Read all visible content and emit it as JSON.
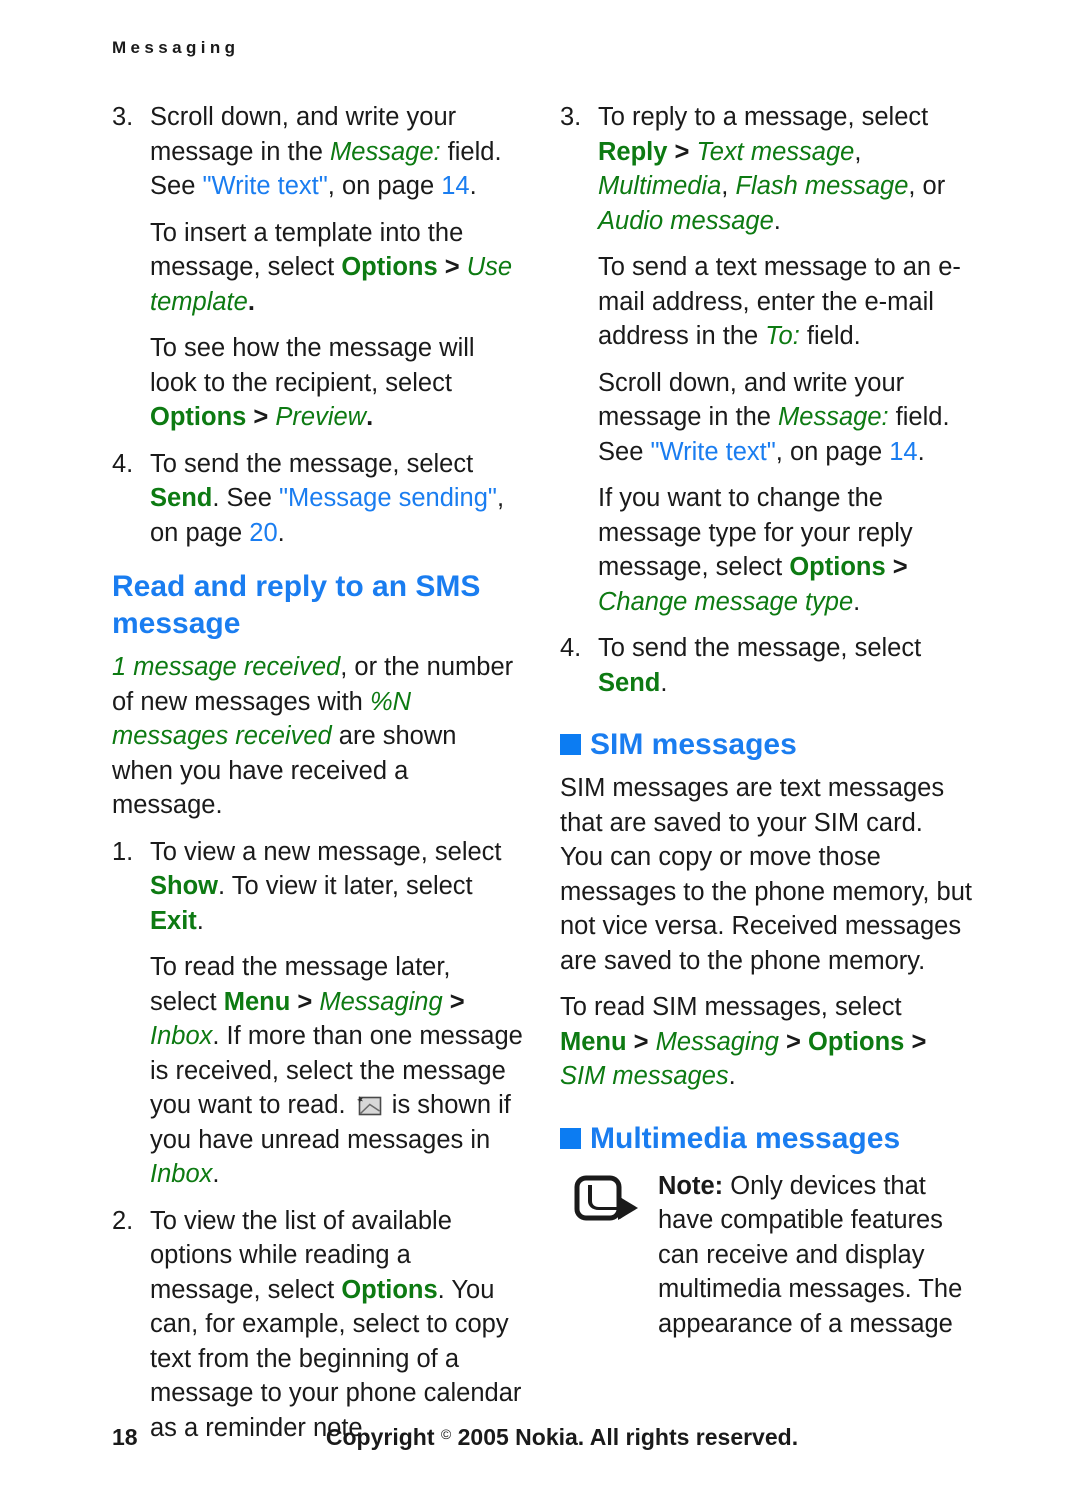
{
  "running_head": "Messaging",
  "colors": {
    "heading_blue": "#1a7df0",
    "ui_green": "#0d7a12",
    "link_blue": "#1a7df0",
    "body_black": "#1a1a1a"
  },
  "left_column": {
    "step3": {
      "number": "3.",
      "line1": "Scroll down, and write your message in the ",
      "field_message": "Message:",
      "line2": " field. See ",
      "link_write_text": "\"Write text\"",
      "line3": ", on page ",
      "page_ref": "14",
      "line4": "."
    },
    "para_template": {
      "t1": "To insert a template into the message, select ",
      "ui_options": "Options",
      "t2": " > ",
      "ui_use_template": "Use template",
      "t3": "."
    },
    "para_preview": {
      "t1": "To see how the message will look to the recipient, select ",
      "ui_options": "Options",
      "t2": " > ",
      "ui_preview": "Preview",
      "t3": "."
    },
    "step4": {
      "number": "4.",
      "t1": "To send the message, select ",
      "ui_send": "Send",
      "t2": ". See ",
      "link_message_sending": "\"Message sending\"",
      "t3": ", on page ",
      "page_ref": "20",
      "t4": "."
    },
    "heading_read_reply": "Read and reply to an SMS message",
    "para_received": {
      "ui_1_message_received": "1 message received",
      "t1": ", or the number of new messages with ",
      "ui_pct_n_messages_received": "%N messages received",
      "t2": " are shown when you have received a message."
    },
    "step1": {
      "number": "1.",
      "t1": "To view a new message, select ",
      "ui_show": "Show",
      "t2": ". To view it later, select ",
      "ui_exit": "Exit",
      "t3": "."
    },
    "para_read_later": {
      "t1": "To read the message later, select ",
      "ui_menu": "Menu",
      "sep1": " > ",
      "ui_messaging": "Messaging",
      "sep2": " > ",
      "ui_inbox": "Inbox",
      "t2": ". If more than one message is received, select the message you want to read. ",
      "icon": "unread-message-envelope-icon",
      "t3": " is shown if you have unread messages in ",
      "ui_inbox2": "Inbox",
      "t4": "."
    },
    "step2": {
      "number": "2.",
      "t1": "To view the list of available options while reading a message, select ",
      "ui_options": "Options",
      "t2": ". You can, for example, select to copy text from the beginning of a message to your phone calendar as a reminder note."
    }
  },
  "right_column": {
    "step3": {
      "number": "3.",
      "t1": "To reply to a message, select ",
      "ui_reply": "Reply",
      "sep": " > ",
      "ui_text_message": "Text message",
      "c1": ", ",
      "ui_multimedia": "Multimedia",
      "c2": ", ",
      "ui_flash_message": "Flash message",
      "c3": ", or ",
      "ui_audio_message": "Audio message",
      "c4": "."
    },
    "para_email": {
      "t1": "To send a text message to an e-mail address, enter the e-mail address in the ",
      "ui_to": "To:",
      "t2": " field."
    },
    "para_scroll": {
      "t1": "Scroll down, and write your message in the ",
      "ui_message": "Message:",
      "t2": " field. See ",
      "link_write_text": "\"Write text\"",
      "t3": ", on page ",
      "page_ref": "14",
      "t4": "."
    },
    "para_change_type": {
      "t1": "If you want to change the message type for your reply message, select ",
      "ui_options": "Options",
      "t2": " > ",
      "ui_change_message_type": "Change message type",
      "t3": "."
    },
    "step4": {
      "number": "4.",
      "t1": "To send the message, select ",
      "ui_send": "Send",
      "t2": "."
    },
    "heading_sim": "SIM messages",
    "para_sim_body": "SIM messages are text messages that are saved to your SIM card. You can copy or move those messages to the phone memory, but not vice versa. Received messages are saved to the phone memory.",
    "para_read_sim": {
      "t1": "To read SIM messages, select ",
      "ui_menu": "Menu",
      "sep1": " > ",
      "ui_messaging": "Messaging",
      "sep2": " > ",
      "ui_options": "Options",
      "sep3": " > ",
      "ui_sim_messages": "SIM messages",
      "t2": "."
    },
    "heading_multimedia": "Multimedia messages",
    "note": {
      "icon": "note-arrow-icon",
      "label": "Note:",
      "text": " Only devices that have compatible features can receive and display multimedia messages. The appearance of a message"
    }
  },
  "footer": {
    "page_number": "18",
    "copyright_pre": "Copyright ",
    "copyright_symbol": "©",
    "copyright_post": " 2005 Nokia. All rights reserved."
  }
}
